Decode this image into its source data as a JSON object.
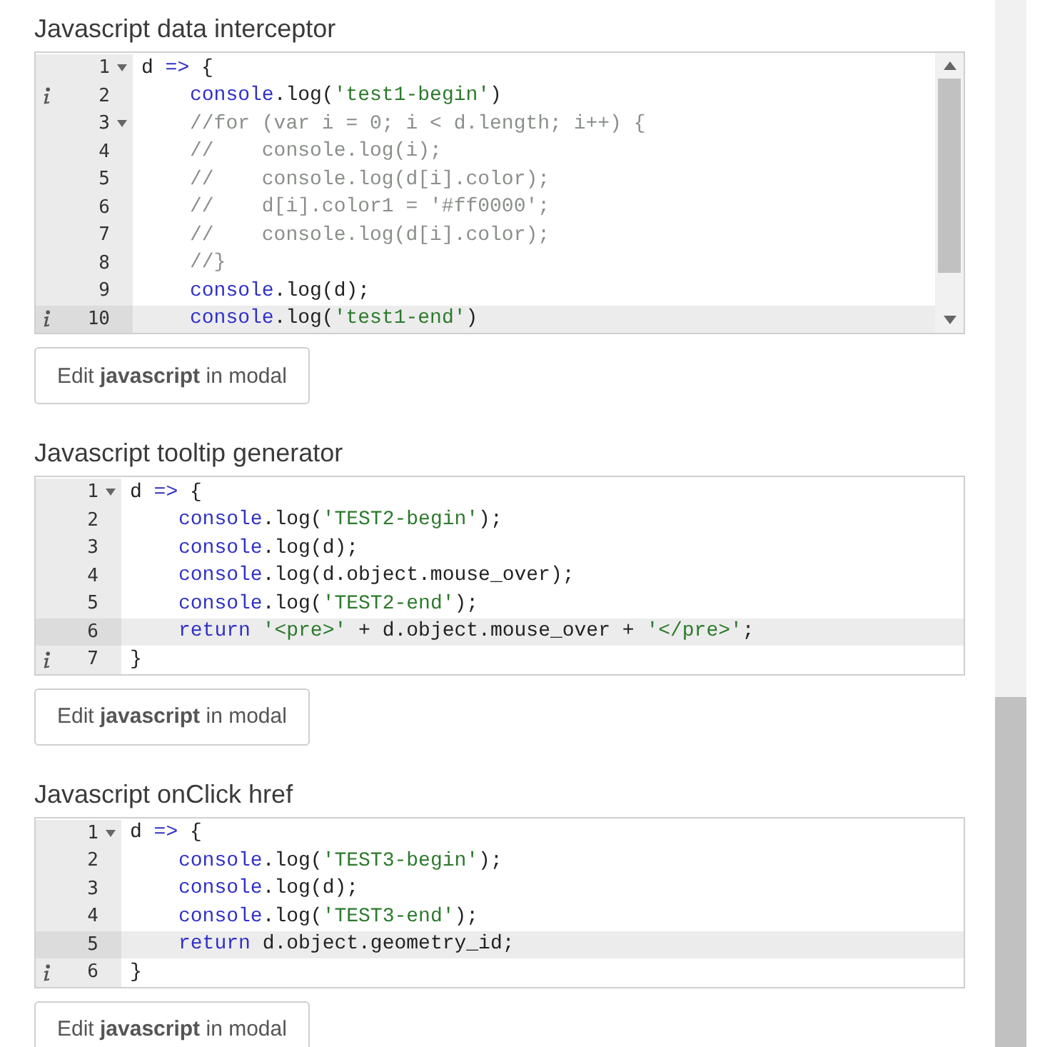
{
  "sections": [
    {
      "title": "Javascript data interceptor",
      "editor": {
        "scrollbar": true,
        "lines": [
          {
            "number": "1",
            "fold": true,
            "info": false,
            "active": false,
            "indent": false,
            "tokens": [
              {
                "kind": "plain",
                "text": "d"
              },
              {
                "kind": "keyword",
                "text": " =>"
              },
              {
                "kind": "plain",
                "text": " {"
              }
            ]
          },
          {
            "number": "2",
            "fold": false,
            "info": true,
            "active": false,
            "indent": true,
            "tokens": [
              {
                "kind": "keyword",
                "text": "console"
              },
              {
                "kind": "plain",
                "text": ".log("
              },
              {
                "kind": "string",
                "text": "'test1-begin'"
              },
              {
                "kind": "plain",
                "text": ")"
              }
            ]
          },
          {
            "number": "3",
            "fold": true,
            "info": false,
            "active": false,
            "indent": true,
            "tokens": [
              {
                "kind": "comment",
                "text": "//for (var i = 0; i < d.length; i++) {"
              }
            ]
          },
          {
            "number": "4",
            "fold": false,
            "info": false,
            "active": false,
            "indent": true,
            "tokens": [
              {
                "kind": "comment",
                "text": "//    console.log(i);"
              }
            ]
          },
          {
            "number": "5",
            "fold": false,
            "info": false,
            "active": false,
            "indent": true,
            "tokens": [
              {
                "kind": "comment",
                "text": "//    console.log(d[i].color);"
              }
            ]
          },
          {
            "number": "6",
            "fold": false,
            "info": false,
            "active": false,
            "indent": true,
            "tokens": [
              {
                "kind": "comment",
                "text": "//    d[i].color1 = '#ff0000';"
              }
            ]
          },
          {
            "number": "7",
            "fold": false,
            "info": false,
            "active": false,
            "indent": true,
            "tokens": [
              {
                "kind": "comment",
                "text": "//    console.log(d[i].color);"
              }
            ]
          },
          {
            "number": "8",
            "fold": false,
            "info": false,
            "active": false,
            "indent": true,
            "tokens": [
              {
                "kind": "comment",
                "text": "//}"
              }
            ]
          },
          {
            "number": "9",
            "fold": false,
            "info": false,
            "active": false,
            "indent": true,
            "tokens": [
              {
                "kind": "keyword",
                "text": "console"
              },
              {
                "kind": "plain",
                "text": ".log(d);"
              }
            ]
          },
          {
            "number": "10",
            "fold": false,
            "info": true,
            "active": true,
            "indent": true,
            "tokens": [
              {
                "kind": "keyword",
                "text": "console"
              },
              {
                "kind": "plain",
                "text": ".log("
              },
              {
                "kind": "string",
                "text": "'test1-end'"
              },
              {
                "kind": "plain",
                "text": ")"
              }
            ]
          }
        ]
      },
      "button": "Edit **javascript** in modal"
    },
    {
      "title": "Javascript tooltip generator",
      "editor": {
        "scrollbar": false,
        "lines": [
          {
            "number": "1",
            "fold": true,
            "info": false,
            "active": false,
            "indent": false,
            "tokens": [
              {
                "kind": "plain",
                "text": "d"
              },
              {
                "kind": "keyword",
                "text": " =>"
              },
              {
                "kind": "plain",
                "text": " {"
              }
            ]
          },
          {
            "number": "2",
            "fold": false,
            "info": false,
            "active": false,
            "indent": true,
            "tokens": [
              {
                "kind": "keyword",
                "text": "console"
              },
              {
                "kind": "plain",
                "text": ".log("
              },
              {
                "kind": "string",
                "text": "'TEST2-begin'"
              },
              {
                "kind": "plain",
                "text": ");"
              }
            ]
          },
          {
            "number": "3",
            "fold": false,
            "info": false,
            "active": false,
            "indent": true,
            "tokens": [
              {
                "kind": "keyword",
                "text": "console"
              },
              {
                "kind": "plain",
                "text": ".log(d);"
              }
            ]
          },
          {
            "number": "4",
            "fold": false,
            "info": false,
            "active": false,
            "indent": true,
            "tokens": [
              {
                "kind": "keyword",
                "text": "console"
              },
              {
                "kind": "plain",
                "text": ".log(d.object.mouse_over);"
              }
            ]
          },
          {
            "number": "5",
            "fold": false,
            "info": false,
            "active": false,
            "indent": true,
            "tokens": [
              {
                "kind": "keyword",
                "text": "console"
              },
              {
                "kind": "plain",
                "text": ".log("
              },
              {
                "kind": "string",
                "text": "'TEST2-end'"
              },
              {
                "kind": "plain",
                "text": ");"
              }
            ]
          },
          {
            "number": "6",
            "fold": false,
            "info": false,
            "active": true,
            "indent": true,
            "tokens": [
              {
                "kind": "keyword",
                "text": "return"
              },
              {
                "kind": "string",
                "text": " '<pre>'"
              },
              {
                "kind": "plain",
                "text": " + d.object.mouse_over + "
              },
              {
                "kind": "string",
                "text": "'</pre>'"
              },
              {
                "kind": "plain",
                "text": ";"
              }
            ]
          },
          {
            "number": "7",
            "fold": false,
            "info": true,
            "active": false,
            "indent": false,
            "tokens": [
              {
                "kind": "plain",
                "text": "}"
              }
            ]
          }
        ]
      },
      "button": "Edit **javascript** in modal"
    },
    {
      "title": "Javascript onClick href",
      "editor": {
        "scrollbar": false,
        "lines": [
          {
            "number": "1",
            "fold": true,
            "info": false,
            "active": false,
            "indent": false,
            "tokens": [
              {
                "kind": "plain",
                "text": "d"
              },
              {
                "kind": "keyword",
                "text": " =>"
              },
              {
                "kind": "plain",
                "text": " {"
              }
            ]
          },
          {
            "number": "2",
            "fold": false,
            "info": false,
            "active": false,
            "indent": true,
            "tokens": [
              {
                "kind": "keyword",
                "text": "console"
              },
              {
                "kind": "plain",
                "text": ".log("
              },
              {
                "kind": "string",
                "text": "'TEST3-begin'"
              },
              {
                "kind": "plain",
                "text": ");"
              }
            ]
          },
          {
            "number": "3",
            "fold": false,
            "info": false,
            "active": false,
            "indent": true,
            "tokens": [
              {
                "kind": "keyword",
                "text": "console"
              },
              {
                "kind": "plain",
                "text": ".log(d);"
              }
            ]
          },
          {
            "number": "4",
            "fold": false,
            "info": false,
            "active": false,
            "indent": true,
            "tokens": [
              {
                "kind": "keyword",
                "text": "console"
              },
              {
                "kind": "plain",
                "text": ".log("
              },
              {
                "kind": "string",
                "text": "'TEST3-end'"
              },
              {
                "kind": "plain",
                "text": ");"
              }
            ]
          },
          {
            "number": "5",
            "fold": false,
            "info": false,
            "active": true,
            "indent": true,
            "tokens": [
              {
                "kind": "keyword",
                "text": "return"
              },
              {
                "kind": "plain",
                "text": " d.object.geometry_id;"
              }
            ]
          },
          {
            "number": "6",
            "fold": false,
            "info": true,
            "active": false,
            "indent": false,
            "tokens": [
              {
                "kind": "plain",
                "text": "}"
              }
            ]
          }
        ]
      },
      "button": "Edit **javascript** in modal"
    }
  ]
}
